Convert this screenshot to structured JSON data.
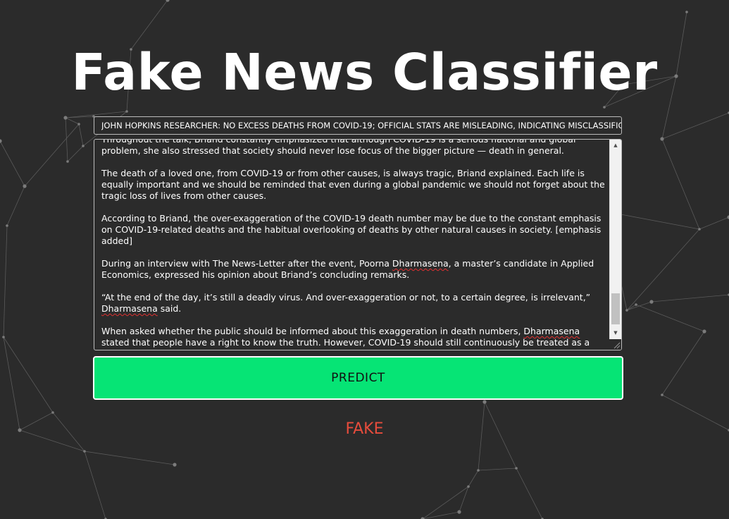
{
  "page": {
    "title": "Fake News Classifier"
  },
  "form": {
    "news_title": "JOHN HOPKINS RESEARCHER: NO EXCESS DEATHS FROM COVID-19; OFFICIAL STATS ARE MISLEADING, INDICATING MISCLASSIFICATION",
    "article_paragraphs": [
      "Throughout the talk, Briand constantly emphasized that although COVID-19 is a serious national and global problem, she also stressed that society should never lose focus of the bigger picture — death in general.",
      "The death of a loved one, from COVID-19 or from other causes, is always tragic, Briand explained. Each life is equally important and we should be reminded that even during a global pandemic we should not forget about the tragic loss of lives from other causes.",
      "According to Briand, the over-exaggeration of the COVID-19 death number may be due to the constant emphasis on COVID-19-related deaths and the habitual overlooking of deaths by other natural causes in society. [emphasis added]",
      "During an interview with The News-Letter after the event, Poorna Dharmasena, a master’s candidate in Applied Economics, expressed his opinion about Briand’s concluding remarks.",
      "“At the end of the day, it’s still a deadly virus. And over-exaggeration or not, to a certain degree, is irrelevant,” Dharmasena said.",
      "When asked whether the public should be informed about this exaggeration in death numbers, Dharmasena stated that people have a right to know the truth. However, COVID-19 should still continuously be treated as a deadly disease to safeguard the vulnerable population."
    ],
    "predict_label": "PREDICT"
  },
  "result": {
    "label": "FAKE",
    "color": "#e74c3c"
  },
  "colors": {
    "background": "#2b2b2b",
    "button": "#06e475"
  }
}
